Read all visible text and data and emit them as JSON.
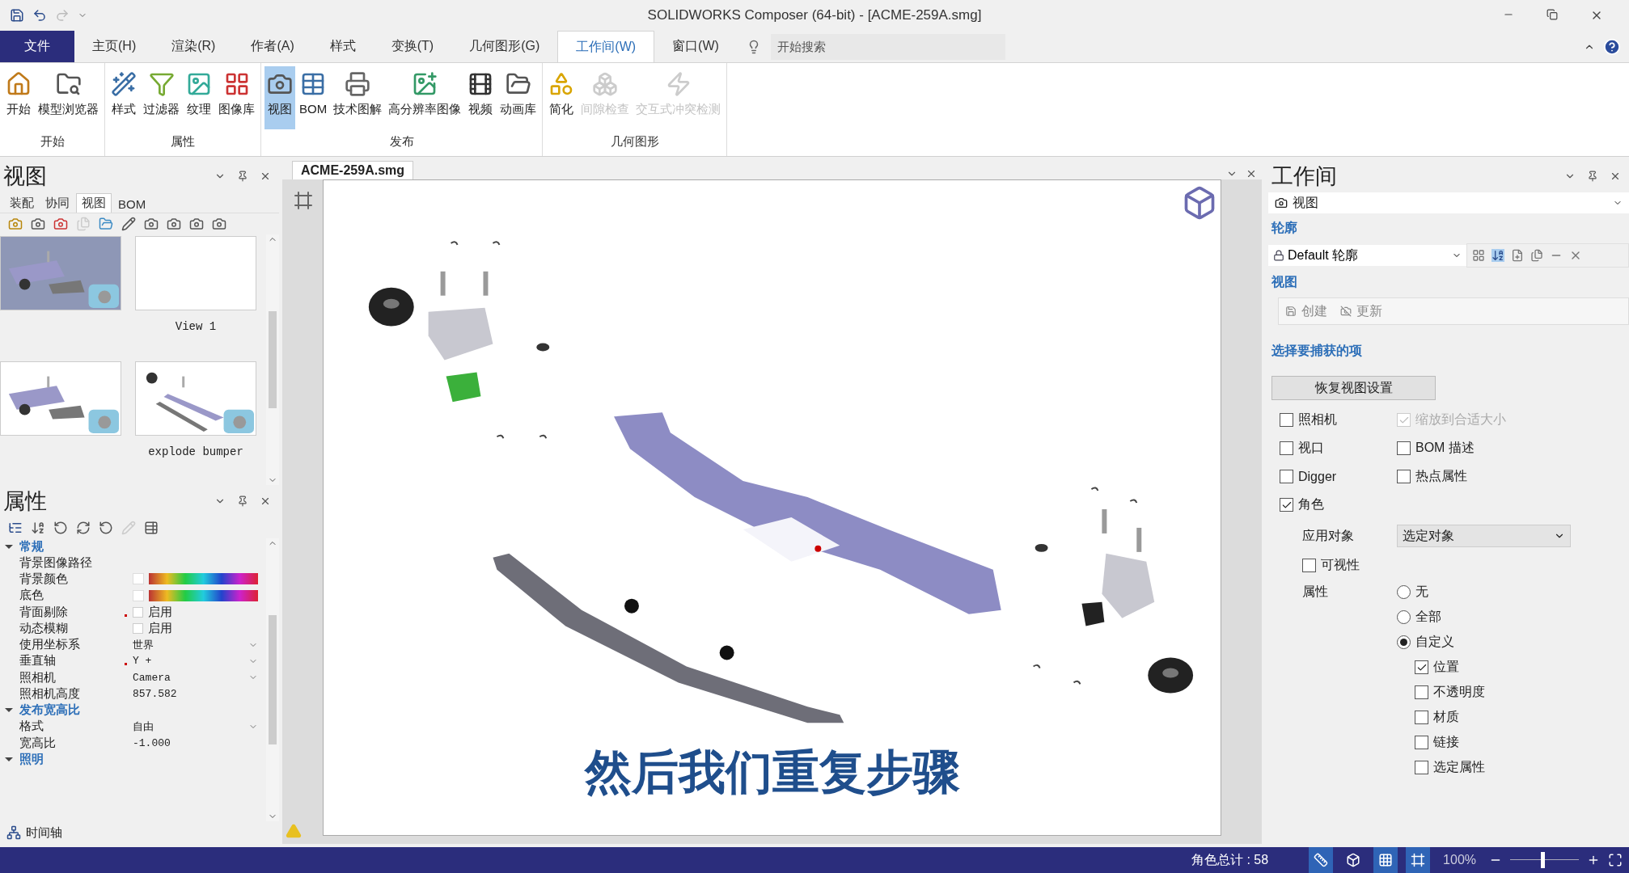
{
  "window": {
    "title": "SOLIDWORKS Composer (64-bit) - [ACME-259A.smg]"
  },
  "ribbon_tabs": [
    {
      "label": "文件",
      "kind": "file",
      "selected": false
    },
    {
      "label": "主页(H)",
      "kind": "tab",
      "selected": false
    },
    {
      "label": "渲染(R)",
      "kind": "tab",
      "selected": false
    },
    {
      "label": "作者(A)",
      "kind": "tab",
      "selected": false
    },
    {
      "label": "样式",
      "kind": "tab",
      "selected": false
    },
    {
      "label": "变换(T)",
      "kind": "tab",
      "selected": false
    },
    {
      "label": "几何图形(G)",
      "kind": "tab",
      "selected": false
    },
    {
      "label": "工作间(W)",
      "kind": "tab",
      "selected": true
    },
    {
      "label": "窗口(W)",
      "kind": "tab",
      "selected": false
    }
  ],
  "search": {
    "placeholder": "开始搜索"
  },
  "ribbon_groups": [
    {
      "label": "开始",
      "buttons": [
        {
          "label": "开始",
          "selected": false,
          "disabled": false
        },
        {
          "label": "模型浏览器",
          "selected": false,
          "disabled": false
        }
      ]
    },
    {
      "label": "属性",
      "buttons": [
        {
          "label": "样式",
          "selected": false,
          "disabled": false
        },
        {
          "label": "过滤器",
          "selected": false,
          "disabled": false
        },
        {
          "label": "纹理",
          "selected": false,
          "disabled": false
        },
        {
          "label": "图像库",
          "selected": false,
          "disabled": false
        }
      ]
    },
    {
      "label": "发布",
      "buttons": [
        {
          "label": "视图",
          "selected": true,
          "disabled": false
        },
        {
          "label": "BOM",
          "selected": false,
          "disabled": false
        },
        {
          "label": "技术图解",
          "selected": false,
          "disabled": false
        },
        {
          "label": "高分辨率图像",
          "selected": false,
          "disabled": false
        },
        {
          "label": "视频",
          "selected": false,
          "disabled": false
        },
        {
          "label": "动画库",
          "selected": false,
          "disabled": false
        }
      ]
    },
    {
      "label": "几何图形",
      "buttons": [
        {
          "label": "简化",
          "selected": false,
          "disabled": false
        },
        {
          "label": "间隙检查",
          "selected": false,
          "disabled": true
        },
        {
          "label": "交互式冲突检测",
          "selected": false,
          "disabled": true
        }
      ]
    }
  ],
  "views_panel": {
    "title": "视图",
    "tabs": [
      {
        "label": "装配",
        "selected": false
      },
      {
        "label": "协同",
        "selected": false
      },
      {
        "label": "视图",
        "selected": true
      },
      {
        "label": "BOM",
        "selected": false
      }
    ],
    "thumbnails": [
      {
        "kind": "picture"
      },
      {
        "kind": "picture",
        "label": "View 1"
      },
      {
        "kind": "picture"
      },
      {
        "kind": "picture",
        "label": "explode bumper"
      }
    ]
  },
  "properties_panel": {
    "title": "属性",
    "groups": [
      {
        "label": "常规",
        "expanded": true,
        "rows": [
          {
            "name": "背景图像路径",
            "kind": "empty",
            "modified": false
          },
          {
            "name": "背景颜色",
            "kind": "color",
            "modified": false
          },
          {
            "name": "底色",
            "kind": "color",
            "modified": false
          },
          {
            "name": "背面剔除",
            "kind": "checkbox",
            "value": "启用",
            "checked": false,
            "modified": true
          },
          {
            "name": "动态模糊",
            "kind": "checkbox",
            "value": "启用",
            "checked": false,
            "modified": false
          },
          {
            "name": "使用坐标系",
            "kind": "dropdown",
            "value": "世界",
            "modified": false
          },
          {
            "name": "垂直轴",
            "kind": "dropdown",
            "value": "Y +",
            "modified": true
          },
          {
            "name": "照相机",
            "kind": "dropdown",
            "value": "Camera",
            "modified": false
          },
          {
            "name": "照相机高度",
            "kind": "text",
            "value": "857.582",
            "modified": false
          }
        ]
      },
      {
        "label": "发布宽高比",
        "expanded": true,
        "rows": [
          {
            "name": "格式",
            "kind": "dropdown",
            "value": "自由",
            "modified": false
          },
          {
            "name": "宽高比",
            "kind": "text",
            "value": "-1.000",
            "modified": false
          }
        ]
      },
      {
        "label": "照明",
        "expanded": true
      }
    ]
  },
  "timeline": {
    "label": "时间轴"
  },
  "document": {
    "tab": "ACME-259A.smg",
    "subtitle": "然后我们重复步骤"
  },
  "workshop_panel": {
    "title": "工作间",
    "selector": "视图",
    "profile_heading": "轮廓",
    "profile": "Default 轮廓",
    "view_heading": "视图",
    "view_actions": [
      {
        "label": "创建",
        "disabled": true
      },
      {
        "label": "更新",
        "disabled": true
      }
    ],
    "capture_heading": "选择要捕获的项",
    "reset_button": "恢复视图设置",
    "capture_options": [
      {
        "label": "照相机",
        "checked": false,
        "disabled": false
      },
      {
        "label": "缩放到合适大小",
        "checked": true,
        "disabled": true
      },
      {
        "label": "视口",
        "checked": false,
        "disabled": false
      },
      {
        "label": "BOM 描述",
        "checked": false,
        "disabled": false
      },
      {
        "label": "Digger",
        "checked": false,
        "disabled": false
      },
      {
        "label": "热点属性",
        "checked": false,
        "disabled": false
      },
      {
        "label": "角色",
        "checked": true,
        "disabled": false
      }
    ],
    "apply_label": "应用对象",
    "apply_value": "选定对象",
    "visibility": {
      "label": "可视性",
      "checked": false
    },
    "properties_label": "属性",
    "property_modes": [
      {
        "label": "无",
        "selected": false
      },
      {
        "label": "全部",
        "selected": false
      },
      {
        "label": "自定义",
        "selected": true
      }
    ],
    "custom_properties": [
      {
        "label": "位置",
        "checked": true
      },
      {
        "label": "不透明度",
        "checked": false
      },
      {
        "label": "材质",
        "checked": false
      },
      {
        "label": "链接",
        "checked": false
      },
      {
        "label": "选定属性",
        "checked": false
      }
    ]
  },
  "status_bar": {
    "count": "角色总计 : 58",
    "toggles": [
      {
        "selected": true
      },
      {
        "selected": false
      },
      {
        "selected": true
      },
      {
        "selected": true
      }
    ],
    "zoom": "100%",
    "zoom_slider": {
      "level": 0.47
    }
  }
}
